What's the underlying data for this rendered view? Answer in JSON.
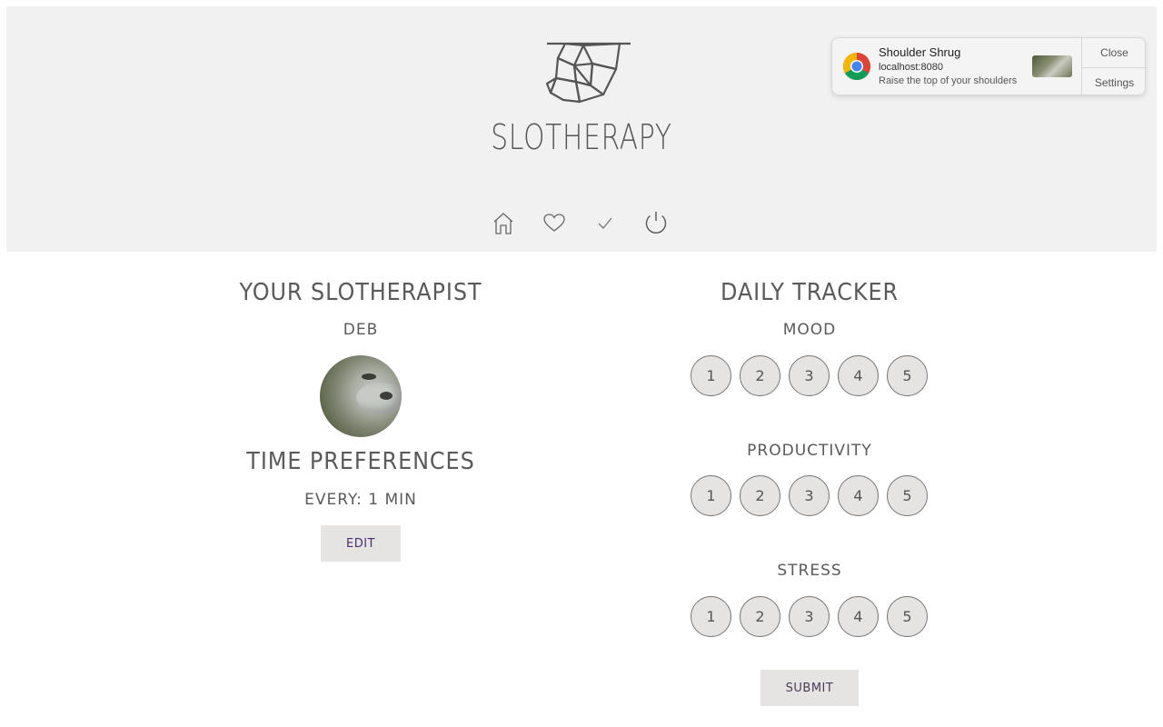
{
  "header": {
    "brand": "SLOTHERAPY",
    "nav": [
      {
        "name": "home-icon"
      },
      {
        "name": "heart-icon"
      },
      {
        "name": "check-icon"
      },
      {
        "name": "power-icon"
      }
    ]
  },
  "notification": {
    "title": "Shoulder Shrug",
    "source": "localhost:8080",
    "body": "Raise the top of your shoulders",
    "actions": {
      "close": "Close",
      "settings": "Settings"
    }
  },
  "therapist": {
    "heading": "YOUR SLOTHERAPIST",
    "name": "DEB"
  },
  "time_preferences": {
    "heading": "TIME PREFERENCES",
    "interval": "EVERY: 1 MIN",
    "edit_label": "EDIT"
  },
  "tracker": {
    "heading": "DAILY TRACKER",
    "categories": [
      {
        "label": "MOOD",
        "options": [
          "1",
          "2",
          "3",
          "4",
          "5"
        ]
      },
      {
        "label": "PRODUCTIVITY",
        "options": [
          "1",
          "2",
          "3",
          "4",
          "5"
        ]
      },
      {
        "label": "STRESS",
        "options": [
          "1",
          "2",
          "3",
          "4",
          "5"
        ]
      }
    ],
    "submit_label": "SUBMIT"
  }
}
